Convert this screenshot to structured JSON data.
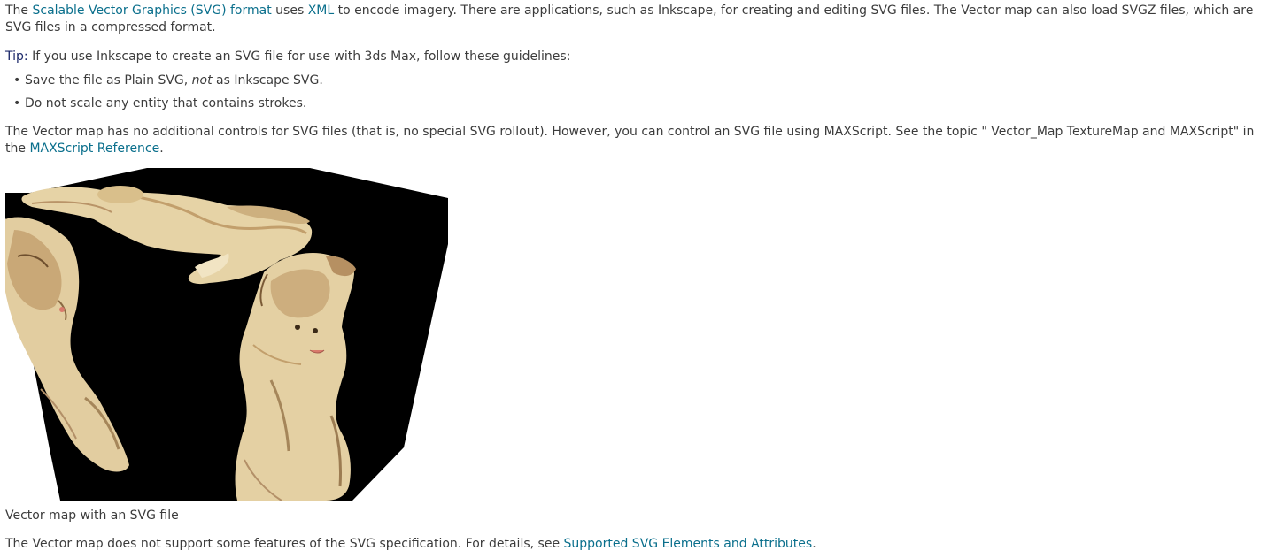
{
  "intro": {
    "text_1": "The ",
    "link_svg_format": "Scalable Vector Graphics (SVG) format",
    "text_2": " uses ",
    "link_xml": "XML",
    "text_3": " to encode imagery. There are applications, such as Inkscape, for creating and editing SVG files. The Vector map can also load SVGZ files, which are SVG files in a compressed format."
  },
  "tip": {
    "label": "Tip:",
    "text": "If you use Inkscape to create an SVG file for use with 3ds Max, follow these guidelines:",
    "items": [
      {
        "before": "Save the file as Plain SVG, ",
        "emphasis": "not",
        "after": " as Inkscape SVG."
      },
      {
        "text": "Do not scale any entity that contains strokes."
      }
    ]
  },
  "controls": {
    "text_1": "The Vector map has no additional controls for SVG files (that is, no special SVG rollout). However, you can control an SVG file using MAXScript. See the topic \" Vector_Map TextureMap and MAXScript\" in the ",
    "link_maxscript": "MAXScript Reference",
    "text_2": "."
  },
  "figure": {
    "caption": "Vector map with an SVG file"
  },
  "support": {
    "text_1": "The Vector map does not support some features of the SVG specification. For details, see ",
    "link_supported": "Supported SVG Elements and Attributes",
    "text_2": "."
  },
  "colors": {
    "link": "#0a6f8c",
    "tip_label": "#1d2a6b",
    "body_text": "#3c3c3c",
    "cube_face": "#000000",
    "cub_fur_light": "#e9d8ae",
    "cub_fur_mid": "#c9a877",
    "cub_fur_dark": "#8a6a43"
  }
}
